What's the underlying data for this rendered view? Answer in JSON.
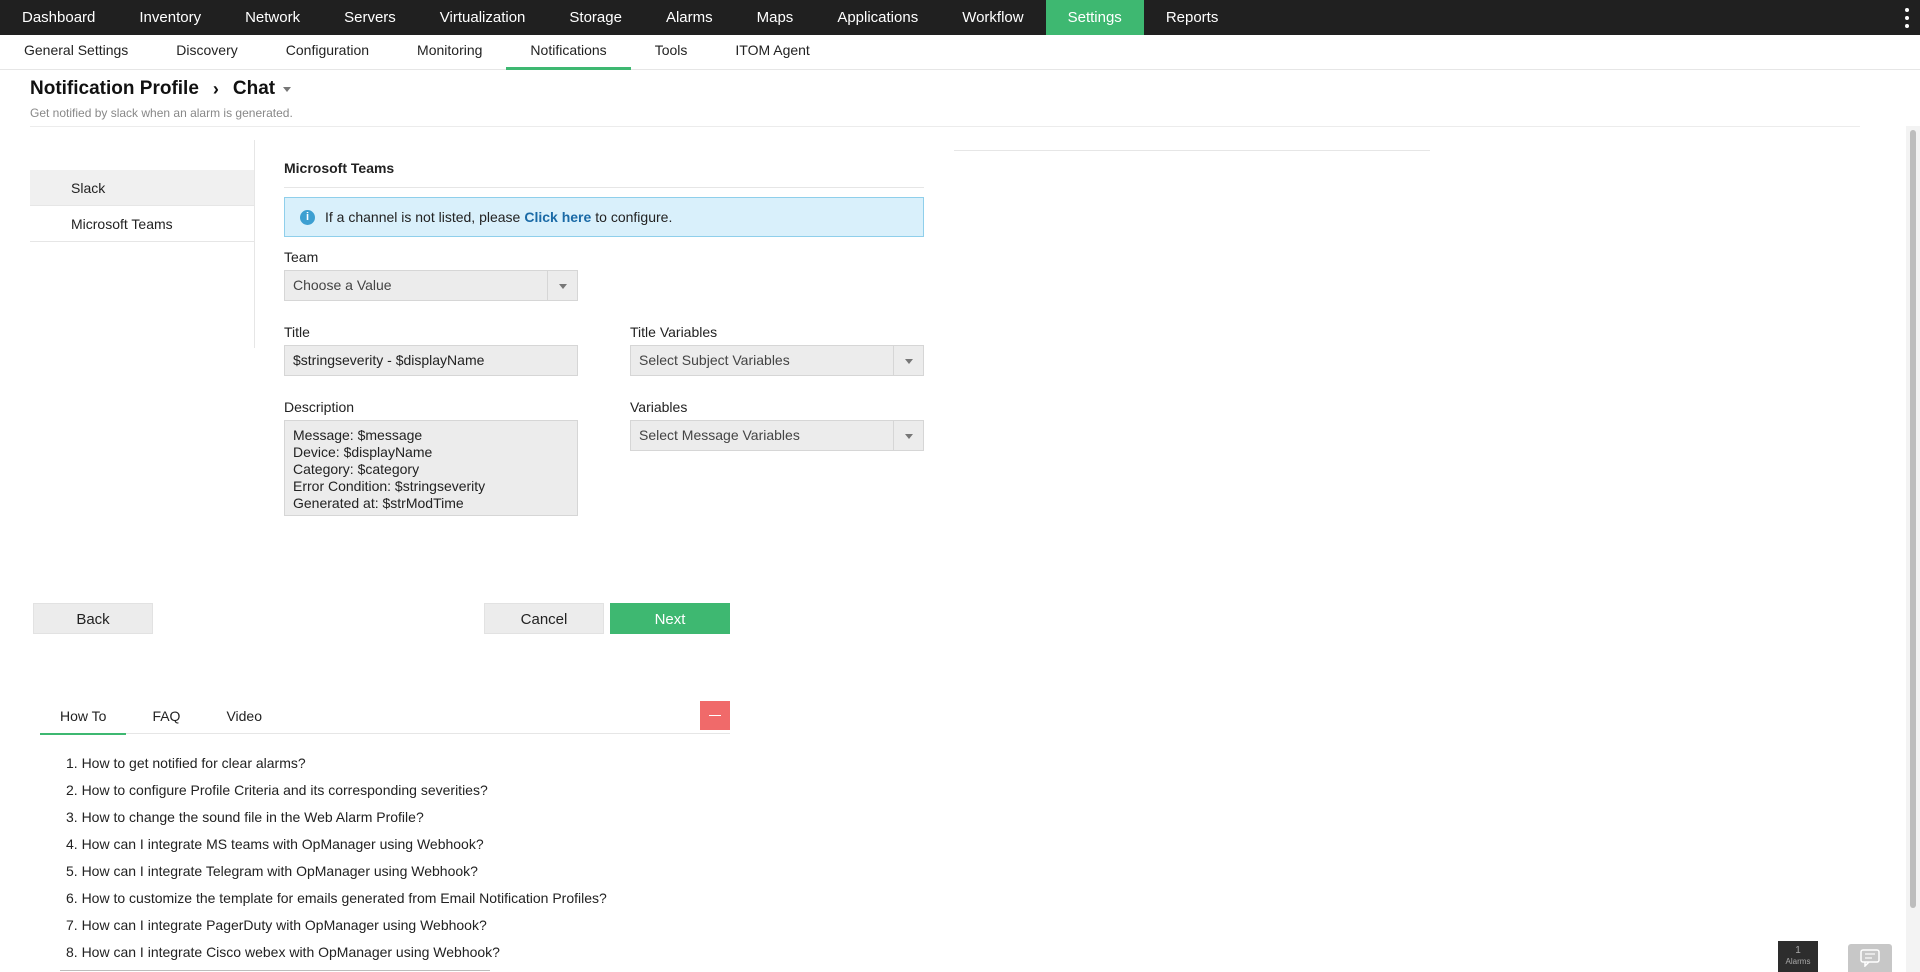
{
  "top_nav": {
    "items": [
      "Dashboard",
      "Inventory",
      "Network",
      "Servers",
      "Virtualization",
      "Storage",
      "Alarms",
      "Maps",
      "Applications",
      "Workflow",
      "Settings",
      "Reports"
    ],
    "active": "Settings"
  },
  "sub_nav": {
    "items": [
      "General Settings",
      "Discovery",
      "Configuration",
      "Monitoring",
      "Notifications",
      "Tools",
      "ITOM Agent"
    ],
    "active": "Notifications"
  },
  "header": {
    "breadcrumb_root": "Notification Profile",
    "breadcrumb_current": "Chat",
    "subtitle": "Get notified by slack when an alarm is generated."
  },
  "channels": {
    "items": [
      "Slack",
      "Microsoft Teams"
    ],
    "active": "Slack"
  },
  "form": {
    "section_title": "Microsoft Teams",
    "info": {
      "before": "If a channel is not listed, please",
      "link": "Click here",
      "after": "to configure."
    },
    "team_label": "Team",
    "team_value": "Choose a Value",
    "title_label": "Title",
    "title_value": "$stringseverity - $displayName",
    "title_variables_label": "Title Variables",
    "title_variables_value": "Select Subject Variables",
    "description_label": "Description",
    "description_lines": [
      "Message: $message",
      "Device: $displayName",
      "Category: $category",
      "Error Condition: $stringseverity",
      "Generated at: $strModTime"
    ],
    "variables_label": "Variables",
    "variables_value": "Select Message Variables"
  },
  "buttons": {
    "back": "Back",
    "cancel": "Cancel",
    "next": "Next"
  },
  "help": {
    "tabs": [
      "How To",
      "FAQ",
      "Video"
    ],
    "active_tab": "How To",
    "items": [
      "1. How to get notified for clear alarms?",
      "2. How to configure Profile Criteria and its corresponding severities?",
      "3. How to change the sound file in the Web Alarm Profile?",
      "4. How can I integrate MS teams with OpManager using Webhook?",
      "5. How can I integrate Telegram with OpManager using Webhook?",
      "6. How to customize the template for emails generated from Email Notification Profiles?",
      "7. How can I integrate PagerDuty with OpManager using Webhook?",
      "8. How can I integrate Cisco webex with OpManager using Webhook?"
    ]
  },
  "widgets": {
    "alarm_count": "1",
    "alarm_label": "Alarms"
  },
  "icons": {
    "info": "info-icon",
    "breadcrumb_separator": "chevron-right-icon",
    "dropdown": "chevron-down-icon",
    "menu": "kebab-menu-icon",
    "minimize": "minimize-icon",
    "chat": "chat-icon"
  },
  "colors": {
    "accent": "#3eb871",
    "nav_bg": "#202020",
    "info_bg": "#d9f0fb",
    "link": "#1a6aa6",
    "minimize": "#f06a6a"
  }
}
